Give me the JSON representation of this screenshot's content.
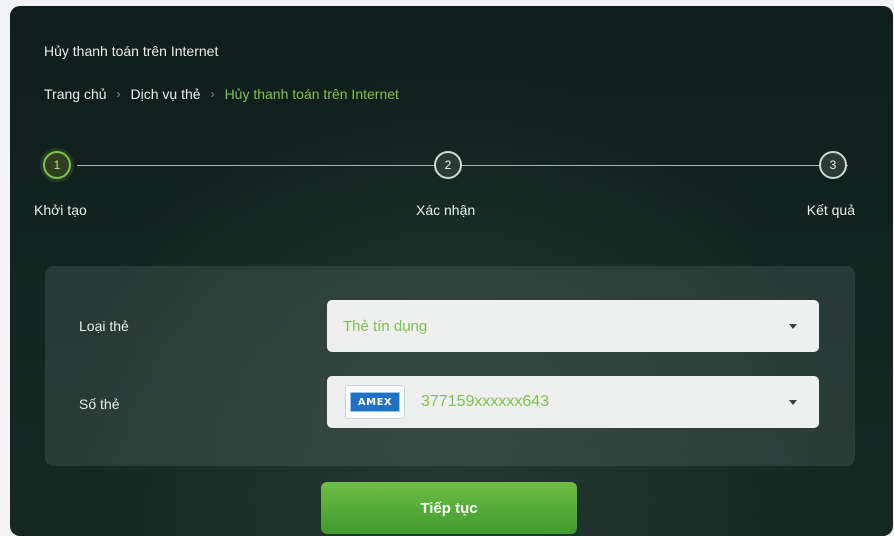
{
  "page": {
    "title": "Hủy thanh toán trên Internet"
  },
  "breadcrumb": {
    "items": [
      "Trang chủ",
      "Dịch vụ thẻ",
      "Hủy thanh toán trên Internet"
    ],
    "separator": "›"
  },
  "stepper": {
    "current_step": 1,
    "steps": [
      {
        "number": "1",
        "label": "Khởi tạo"
      },
      {
        "number": "2",
        "label": "Xác nhận"
      },
      {
        "number": "3",
        "label": "Kết quả"
      }
    ]
  },
  "form": {
    "card_type": {
      "label": "Loại thẻ",
      "value": "Thẻ tín dụng"
    },
    "card_number": {
      "label": "Số thẻ",
      "brand": "AMEX",
      "value": "377159xxxxxx643"
    }
  },
  "actions": {
    "continue_label": "Tiếp tục"
  },
  "colors": {
    "accent": "#7ec24a",
    "button": "#4ea735",
    "background": "#13231f"
  }
}
